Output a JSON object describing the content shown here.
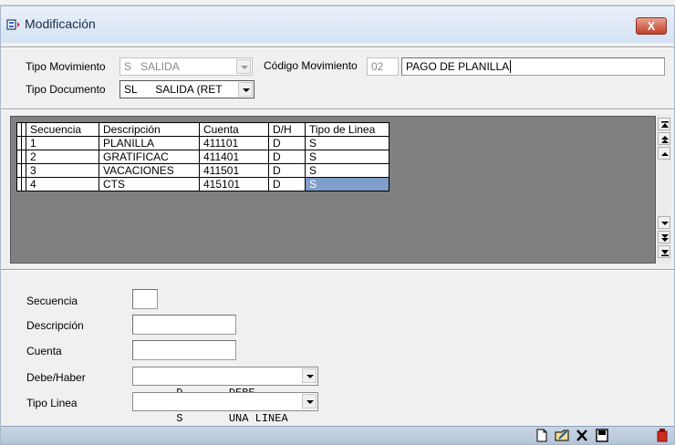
{
  "window": {
    "title": "Modificación",
    "close_label": "X"
  },
  "header": {
    "tipo_movimiento_label": "Tipo Movimiento",
    "tipo_movimiento_value": "S   SALIDA",
    "codigo_movimiento_label": "Código Movimiento",
    "codigo_movimiento_value": "02",
    "descripcion_movimiento_value": "PAGO DE PLANILLA",
    "tipo_documento_label": "Tipo Documento",
    "tipo_documento_value": "SL      SALIDA (RET"
  },
  "grid": {
    "columns": [
      "Secuencia",
      "Descripción",
      "Cuenta",
      "D/H",
      "Tipo de Linea"
    ],
    "rows": [
      [
        "1",
        "PLANILLA",
        "411101",
        "D",
        "S"
      ],
      [
        "2",
        "GRATIFICAC",
        "411401",
        "D",
        "S"
      ],
      [
        "3",
        "VACACIONES",
        "411501",
        "D",
        "S"
      ],
      [
        "4",
        "CTS",
        "415101",
        "D",
        "S"
      ]
    ],
    "selected_row": 3
  },
  "form": {
    "secuencia_label": "Secuencia",
    "secuencia_value": "",
    "descripcion_label": "Descripción",
    "descripcion_value": "",
    "cuenta_label": "Cuenta",
    "cuenta_value": "",
    "debe_haber_label": "Debe/Haber",
    "debe_haber_value": "D       DEBE",
    "tipo_linea_label": "Tipo Linea",
    "tipo_linea_value": "S       UNA LINEA"
  },
  "toolbar_icons": [
    "new-icon",
    "edit-icon",
    "delete-icon",
    "save-icon",
    "exit-icon"
  ],
  "colors": {
    "selection": "#7f9ec9",
    "grid_bg": "#808080",
    "close_button": "#c74a33"
  }
}
